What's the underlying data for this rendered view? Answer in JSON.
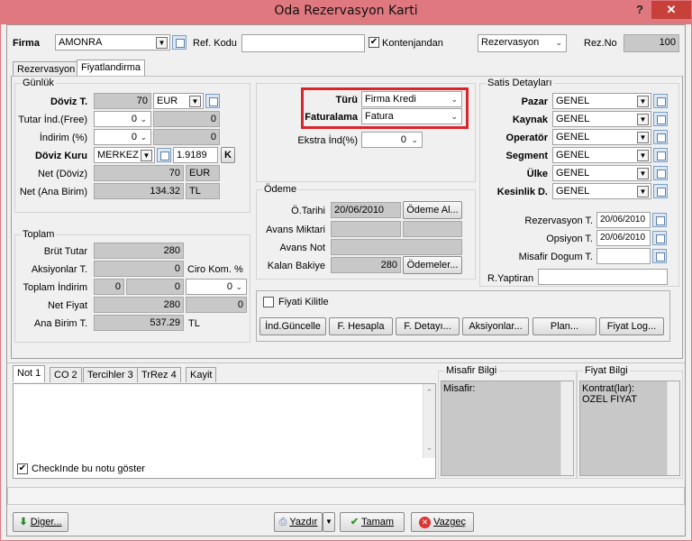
{
  "window": {
    "title": "Oda Rezervasyon Karti",
    "help": "?",
    "close": "✕"
  },
  "top": {
    "firma_label": "Firma",
    "firma_value": "AMONRA",
    "ref_kodu_label": "Ref. Kodu",
    "ref_kodu_value": "",
    "kontenjandan_label": "Kontenjandan",
    "kontenjandan_checked": "✔",
    "rez_type": "Rezervasyon",
    "rez_no_label": "Rez.No",
    "rez_no_value": "100"
  },
  "tabs": {
    "rezervasyon": "Rezervasyon",
    "fiyatlandirma": "Fiyatlandirma"
  },
  "gunluk": {
    "title": "Günlük",
    "doviz_t_label": "Döviz T.",
    "doviz_t_value": "70",
    "doviz_t_currency": "EUR",
    "tutar_ind_label": "Tutar İnd.(Free)",
    "tutar_ind_sel": "0",
    "tutar_ind_value": "0",
    "indirim_label": "İndirim (%)",
    "indirim_sel": "0",
    "indirim_value": "0",
    "doviz_kuru_label": "Döviz Kuru",
    "doviz_kuru_source": "MERKEZ",
    "doviz_kuru_value": "1.9189",
    "k_button": "K",
    "net_doviz_label": "Net (Döviz)",
    "net_doviz_value": "70",
    "net_doviz_currency": "EUR",
    "net_ana_label": "Net (Ana Birim)",
    "net_ana_value": "134.32",
    "net_ana_currency": "TL"
  },
  "toplam": {
    "title": "Toplam",
    "brut_label": "Brüt Tutar",
    "brut_value": "280",
    "aksiyonlar_label": "Aksiyonlar T.",
    "aksiyonlar_value": "0",
    "ciro_label": "Ciro Kom. %",
    "toplam_ind_label": "Toplam İndirim",
    "toplam_ind_a": "0",
    "toplam_ind_b": "0",
    "toplam_ind_sel": "0",
    "net_fiyat_label": "Net Fiyat",
    "net_fiyat_value": "280",
    "net_fiyat_b": "0",
    "ana_birim_label": "Ana Birim T.",
    "ana_birim_value": "537.29",
    "ana_birim_currency": "TL"
  },
  "turu": {
    "turu_label": "Türü",
    "turu_value": "Firma Kredi",
    "faturalama_label": "Faturalama",
    "faturalama_value": "Fatura",
    "ekstra_label": "Ekstra İnd(%)",
    "ekstra_value": "0"
  },
  "odeme": {
    "title": "Ödeme",
    "tarih_label": "Ö.Tarihi",
    "tarih_value": "20/06/2010",
    "odeme_al_button": "Ödeme Al...",
    "avans_miktari_label": "Avans Miktari",
    "avans_not_label": "Avans Not",
    "kalan_label": "Kalan Bakiye",
    "kalan_value": "280",
    "odemeler_button": "Ödemeler..."
  },
  "satis": {
    "title": "Satis Detayları",
    "rows": [
      {
        "label": "Pazar",
        "value": "GENEL"
      },
      {
        "label": "Kaynak",
        "value": "GENEL"
      },
      {
        "label": "Operatör",
        "value": "GENEL"
      },
      {
        "label": "Segment",
        "value": "GENEL"
      },
      {
        "label": "Ülke",
        "value": "GENEL"
      },
      {
        "label": "Kesinlik D.",
        "value": "GENEL"
      }
    ],
    "rez_t_label": "Rezervasyon T.",
    "rez_t_value": "20/06/2010",
    "opsiyon_label": "Opsiyon T.",
    "opsiyon_value": "20/06/2010",
    "misafir_dogum_label": "Misafir Dogum T.",
    "r_yaptiran_label": "R.Yaptiran"
  },
  "fiyati_kilitle": "Fiyati Kilitle",
  "actions": [
    "İnd.Güncelle",
    "F. Hesapla",
    "F. Detayı...",
    "Aksiyonlar...",
    "Plan...",
    "Fiyat Log..."
  ],
  "note_tabs": [
    "Not 1",
    "CO 2",
    "Tercihler 3",
    "TrRez 4",
    "Kayit"
  ],
  "checkin_note": "CheckInde bu notu göster",
  "misafir_bilgi": {
    "title": "Misafir Bilgi",
    "text": "Misafir:"
  },
  "fiyat_bilgi": {
    "title": "Fiyat Bilgi",
    "line1": "Kontrat(lar):",
    "line2": "OZEL FIYAT"
  },
  "footer": {
    "diger": "Diger...",
    "yazdir": "Yazdır",
    "tamam": "Tamam",
    "vazgec": "Vazgeç"
  },
  "colors": {
    "titlebar": "#e0787f",
    "close": "#c7403a",
    "highlight": "#d9252b"
  }
}
